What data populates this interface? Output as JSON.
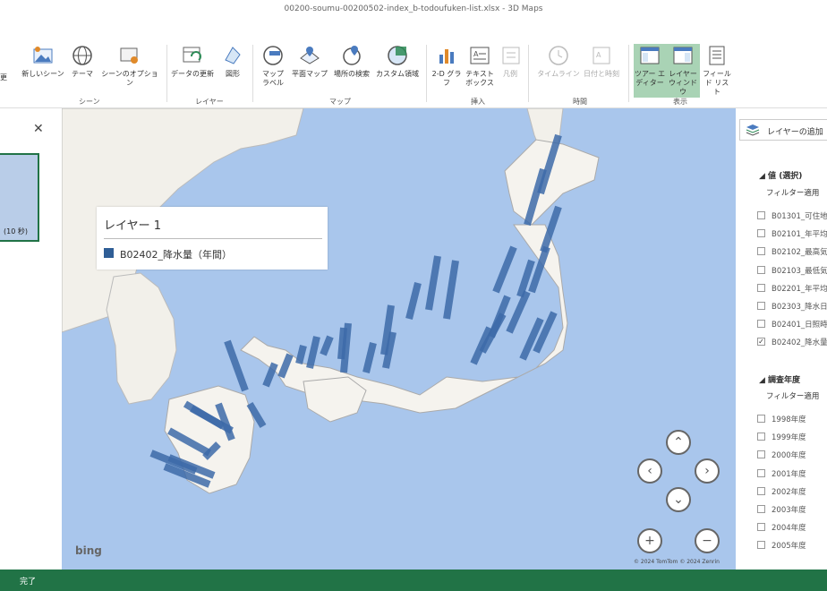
{
  "window": {
    "title": "00200-soumu-00200502-index_b-todoufuken-list.xlsx - 3D Maps"
  },
  "ribbon": {
    "buttons": [
      {
        "label": "更",
        "group": "scene"
      },
      {
        "label": "新しいシーン",
        "group": "scene"
      },
      {
        "label": "テーマ",
        "group": "scene"
      },
      {
        "label": "シーンのオプション",
        "group": "scene"
      },
      {
        "label": "データの更新",
        "group": "layer"
      },
      {
        "label": "図形",
        "group": "layer"
      },
      {
        "label": "マップ ラベル",
        "group": "map"
      },
      {
        "label": "平面マップ",
        "group": "map"
      },
      {
        "label": "場所の検索",
        "group": "map"
      },
      {
        "label": "カスタム領域",
        "group": "map"
      },
      {
        "label": "2-D グラフ",
        "group": "insert"
      },
      {
        "label": "テキスト ボックス",
        "group": "insert"
      },
      {
        "label": "凡例",
        "group": "insert"
      },
      {
        "label": "タイムライン",
        "group": "time"
      },
      {
        "label": "日付と時刻",
        "group": "time"
      },
      {
        "label": "ツアー エディター",
        "group": "view"
      },
      {
        "label": "レイヤー ウィンドウ",
        "group": "view"
      },
      {
        "label": "フィールド リスト",
        "group": "view"
      }
    ],
    "groups": [
      "シーン",
      "レイヤー",
      "マップ",
      "挿入",
      "時間",
      "表示"
    ]
  },
  "left_panel": {
    "thumb_label": "(10 秒)"
  },
  "legend": {
    "title": "レイヤー 1",
    "item": "B02402_降水量（年間）",
    "color": "#2f5e96"
  },
  "map": {
    "brand": "bing",
    "copyright": "© 2024 TomTom  © 2024 Zenrin",
    "bar_color": "#3d6aa8"
  },
  "right_panel": {
    "add_layer": "レイヤーの追加",
    "value_section": "◢ 値 (選択)",
    "value_filter": "フィルター適用",
    "value_items": [
      {
        "label": "B01301_可住地",
        "checked": false
      },
      {
        "label": "B02101_年平均",
        "checked": false
      },
      {
        "label": "B02102_最高気",
        "checked": false
      },
      {
        "label": "B02103_最低気",
        "checked": false
      },
      {
        "label": "B02201_年平均",
        "checked": false
      },
      {
        "label": "B02303_降水日",
        "checked": false
      },
      {
        "label": "B02401_日照時",
        "checked": false
      },
      {
        "label": "B02402_降水量",
        "checked": true
      }
    ],
    "year_section": "◢ 調査年度",
    "year_filter": "フィルター適用",
    "year_items": [
      "1998年度",
      "1999年度",
      "2000年度",
      "2001年度",
      "2002年度",
      "2003年度",
      "2004年度",
      "2005年度"
    ]
  },
  "status": {
    "text": "完了"
  }
}
